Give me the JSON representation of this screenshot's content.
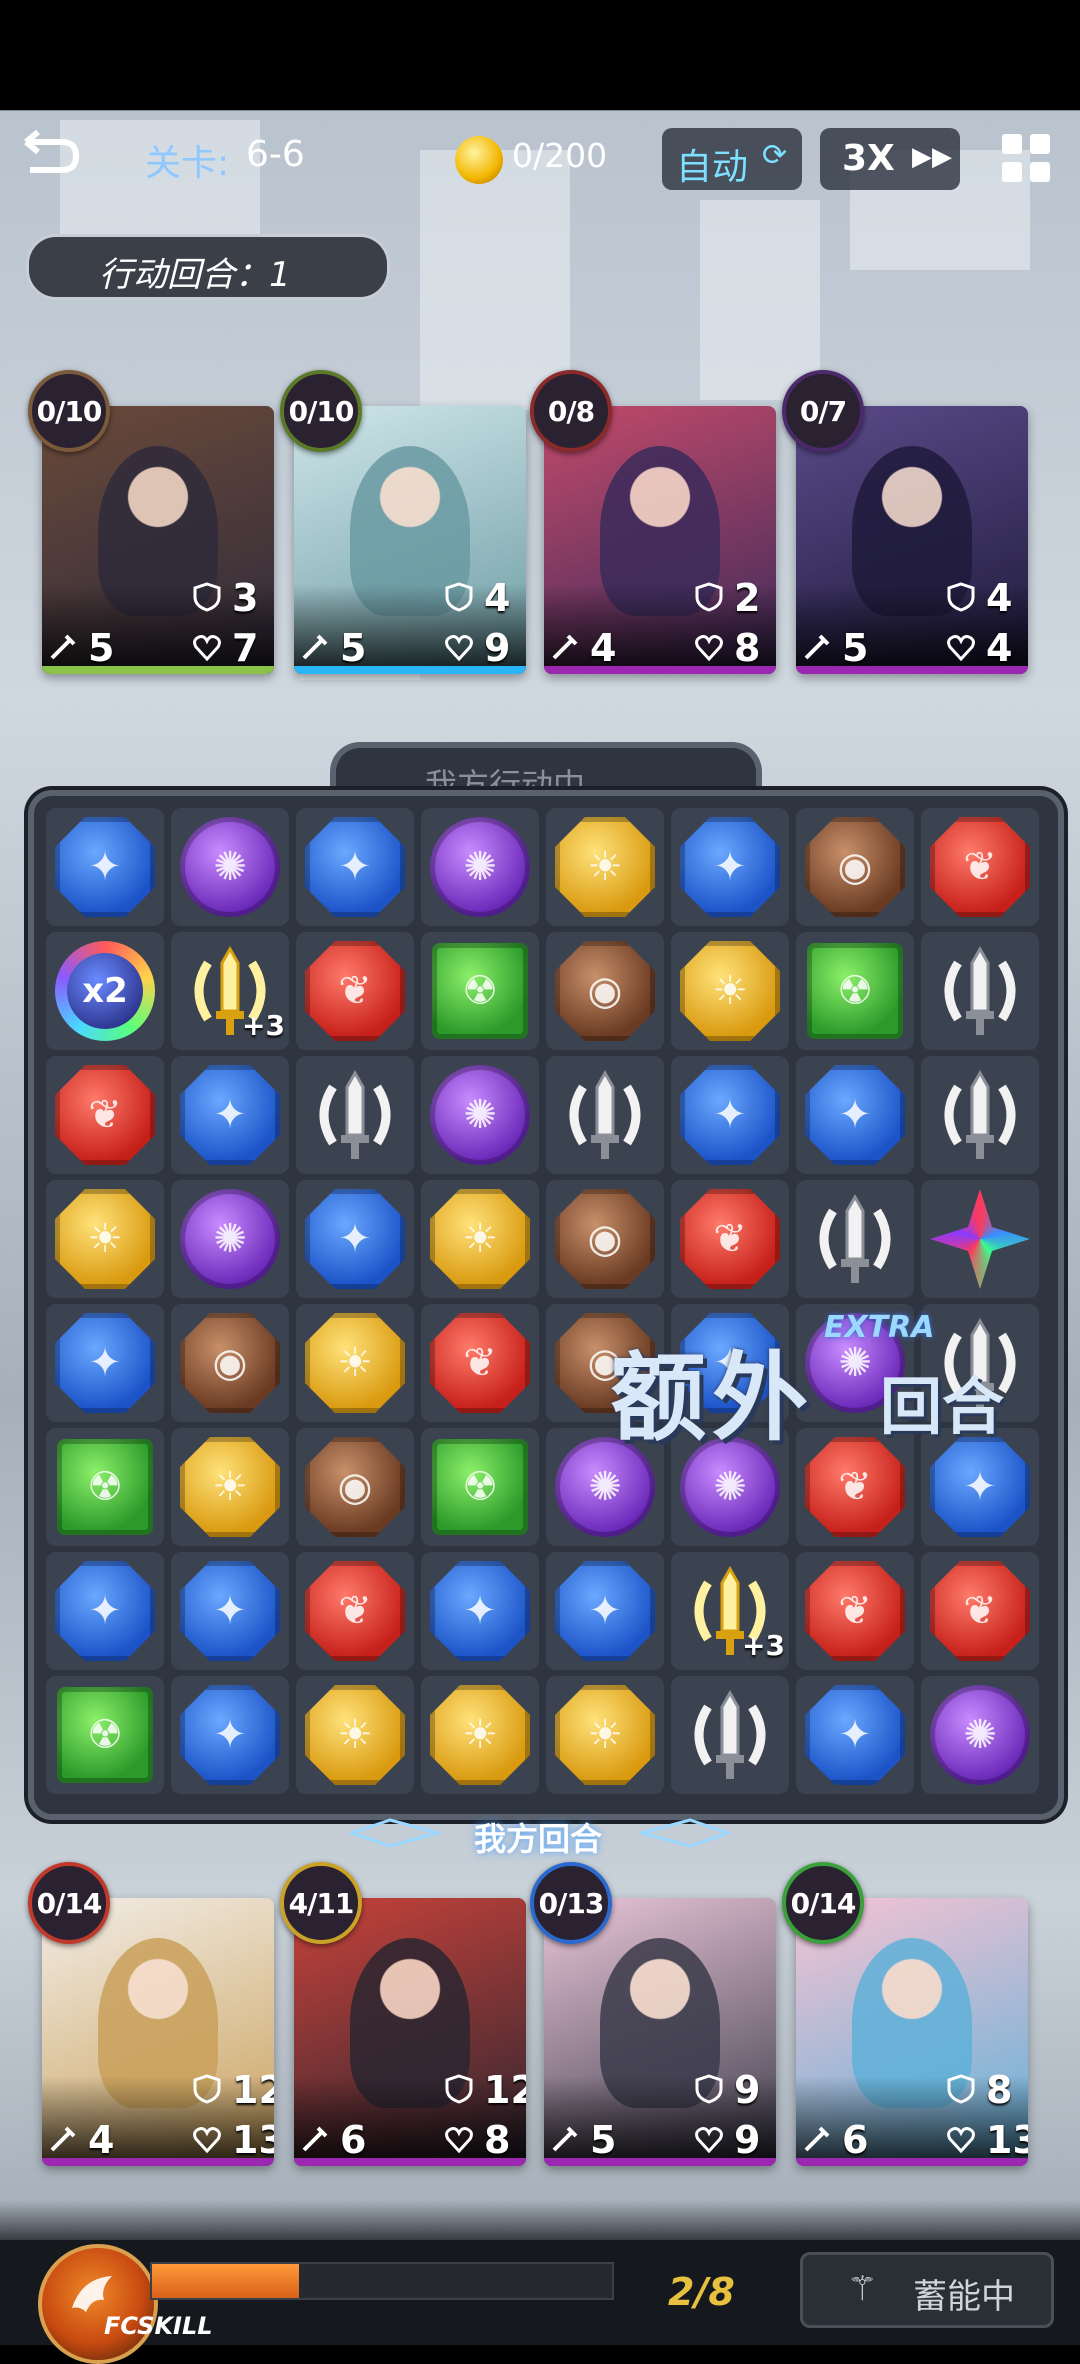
{
  "top_bar": {
    "stage_label": "关卡:",
    "stage_value": "6-6",
    "coins": "0/200",
    "auto_label": "自动",
    "speed_label": "3X"
  },
  "round_counter": "行动回合：1",
  "enemies": [
    {
      "charge": "0/10",
      "attack": "5",
      "shield": "3",
      "hp": "7",
      "strip": "#8bc34a",
      "art": [
        "#6b4a3a",
        "#2e2a3a"
      ],
      "charge_color": "#7a5a3a"
    },
    {
      "charge": "0/10",
      "attack": "5",
      "shield": "4",
      "hp": "9",
      "strip": "#29b6f6",
      "art": [
        "#cfe6ea",
        "#6a9aa2"
      ],
      "charge_color": "#5a7a2a"
    },
    {
      "charge": "0/8",
      "attack": "4",
      "shield": "2",
      "hp": "8",
      "strip": "#9c27b0",
      "art": [
        "#c34a6a",
        "#3a2a5a"
      ],
      "charge_color": "#8a2a2a"
    },
    {
      "charge": "0/7",
      "attack": "5",
      "shield": "4",
      "hp": "4",
      "strip": "#9c27b0",
      "art": [
        "#5a4a8a",
        "#1e1a3a"
      ],
      "charge_color": "#4a2a6a"
    }
  ],
  "board": {
    "status_label": "我方行动中...",
    "turn_banner": "我方回合",
    "extra_turn_text": "额外",
    "extra_turn_text2": "回合",
    "extra_turn_en": "EXTRA",
    "x2_label": "x2",
    "plus_label": "+3",
    "grid": [
      [
        "blue",
        "purple",
        "blue",
        "purple",
        "yellow",
        "blue",
        "brown",
        "red"
      ],
      [
        "rainbow",
        "sword_gold",
        "red",
        "green",
        "brown",
        "yellow",
        "green",
        "sword"
      ],
      [
        "red",
        "blue",
        "sword",
        "purple",
        "sword",
        "blue",
        "blue",
        "sword"
      ],
      [
        "yellow",
        "purple",
        "blue",
        "yellow",
        "brown",
        "red",
        "sword",
        "star"
      ],
      [
        "blue",
        "brown",
        "yellow",
        "red",
        "brown",
        "blue",
        "purple",
        "sword"
      ],
      [
        "green",
        "yellow",
        "brown",
        "green",
        "purple",
        "purple",
        "red",
        "blue"
      ],
      [
        "blue",
        "blue",
        "red",
        "blue",
        "blue",
        "sword_gold",
        "red",
        "red"
      ],
      [
        "green",
        "blue",
        "yellow",
        "yellow",
        "yellow",
        "sword",
        "blue",
        "purple"
      ]
    ]
  },
  "heroes": [
    {
      "charge": "0/14",
      "attack": "4",
      "shield": "12",
      "hp": "13",
      "strip": "#9c27b0",
      "art": [
        "#f2ede6",
        "#c9a05a"
      ],
      "charge_color": "#c0392b"
    },
    {
      "charge": "4/11",
      "attack": "6",
      "shield": "12",
      "hp": "8",
      "strip": "#9c27b0",
      "art": [
        "#c8423a",
        "#2a2530"
      ],
      "charge_color": "#c9a227"
    },
    {
      "charge": "0/13",
      "attack": "5",
      "shield": "9",
      "hp": "9",
      "strip": "#9c27b0",
      "art": [
        "#e9c6d8",
        "#3a3a4a"
      ],
      "charge_color": "#2a6ad0"
    },
    {
      "charge": "0/14",
      "attack": "6",
      "shield": "8",
      "hp": "13",
      "strip": "#9c27b0",
      "art": [
        "#f6c3d3",
        "#5fb0d8"
      ],
      "charge_color": "#3aa03a"
    }
  ],
  "bottom_bar": {
    "skill_label": "FCSKILL",
    "energy": "2/8",
    "energy_fraction": 0.32,
    "charge_button": "蓄能中"
  },
  "colors": {
    "blue": [
      "#6aa8ff",
      "#1c54c8"
    ],
    "purple": [
      "#c88cff",
      "#6a28b8"
    ],
    "yellow": [
      "#ffe27a",
      "#d99a10"
    ],
    "red": [
      "#ff7a6a",
      "#c6201a"
    ],
    "green": [
      "#8cf06a",
      "#2c9a2a"
    ],
    "brown": [
      "#c8906a",
      "#6a3a22"
    ],
    "sword": [
      "#f2f2f2",
      "#8a8f98"
    ],
    "sword_gold": [
      "#fff1a0",
      "#d9a010"
    ],
    "rainbow": [
      "#7ad0ff",
      "#3a2aa0"
    ],
    "star": [
      "#ff4a6a",
      "#3a2aa0"
    ]
  }
}
